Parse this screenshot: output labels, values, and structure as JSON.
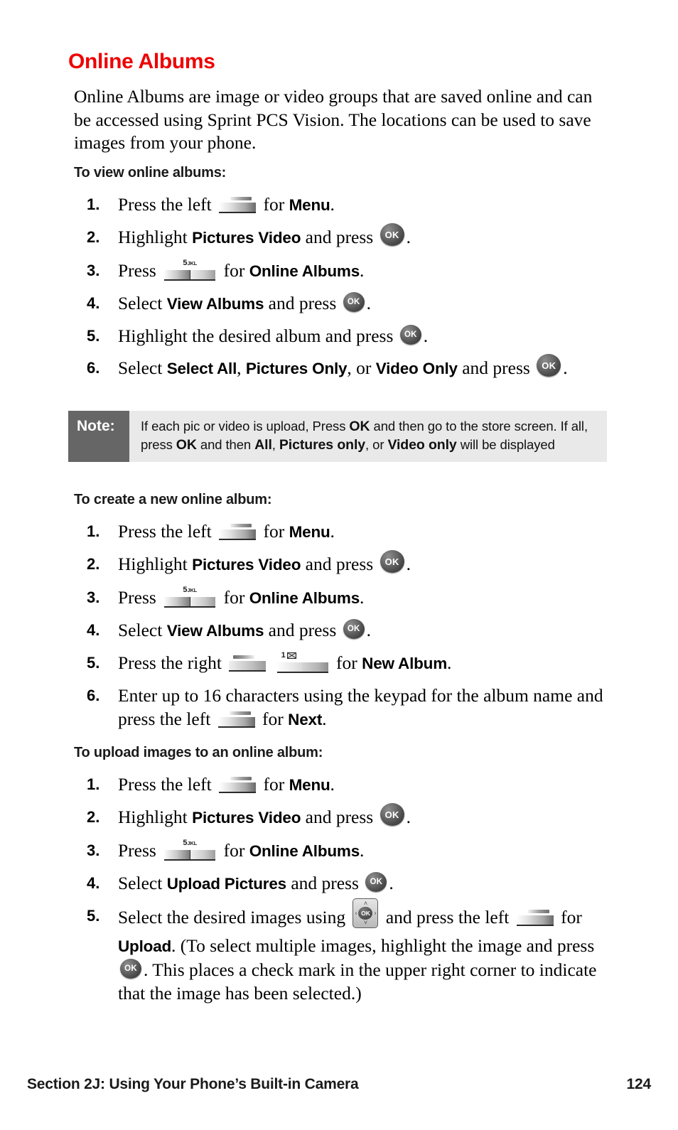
{
  "document": {
    "title": "Online Albums",
    "title_color": "#ee0000",
    "intro": "Online Albums are image or video groups that are saved online and can be accessed using Sprint PCS Vision. The locations can be used to save images from your phone."
  },
  "sections": {
    "view": {
      "heading": "To view online albums:",
      "steps": {
        "s1": {
          "num": "1.",
          "a": "Press the left",
          "b": "for",
          "strong": "Menu",
          "tail": "."
        },
        "s2": {
          "num": "2.",
          "a": "Highlight",
          "strong": "Pictures Video",
          "b": "and press",
          "tail": "."
        },
        "s3": {
          "num": "3.",
          "a": "Press",
          "b": "for",
          "strong": "Online Albums",
          "tail": "."
        },
        "s4": {
          "num": "4.",
          "a": "Select",
          "strong": "View Albums",
          "b": "and press",
          "tail": "."
        },
        "s5": {
          "num": "5.",
          "a": "Highlight the desired album and press",
          "tail": "."
        },
        "s6": {
          "num": "6.",
          "a": "Select",
          "strong1": "Select All",
          "sep1": ",",
          "strong2": "Pictures Only",
          "sep2": ", or",
          "strong3": "Video Only",
          "b": "and press",
          "tail": "."
        }
      }
    },
    "create": {
      "heading": "To create a new online album:",
      "steps": {
        "s1": {
          "num": "1.",
          "a": "Press the left",
          "b": "for",
          "strong": "Menu",
          "tail": "."
        },
        "s2": {
          "num": "2.",
          "a": "Highlight",
          "strong": "Pictures Video",
          "b": "and press",
          "tail": "."
        },
        "s3": {
          "num": "3.",
          "a": "Press",
          "b": "for",
          "strong": "Online Albums",
          "tail": "."
        },
        "s4": {
          "num": "4.",
          "a": "Select",
          "strong": "View Albums",
          "b": "and press",
          "tail": "."
        },
        "s5": {
          "num": "5.",
          "a": "Press the right",
          "b": "for",
          "strong": "New Album",
          "tail": "."
        },
        "s6": {
          "num": "6.",
          "a": "Enter up to 16 characters using the keypad for the album name and press the left",
          "b": "for",
          "strong": "Next",
          "tail": "."
        }
      }
    },
    "upload": {
      "heading": "To upload images to an online album:",
      "steps": {
        "s1": {
          "num": "1.",
          "a": "Press the left",
          "b": "for",
          "strong": "Menu",
          "tail": "."
        },
        "s2": {
          "num": "2.",
          "a": "Highlight",
          "strong": "Pictures Video",
          "b": "and press",
          "tail": "."
        },
        "s3": {
          "num": "3.",
          "a": "Press",
          "b": "for",
          "strong": "Online Albums",
          "tail": "."
        },
        "s4": {
          "num": "4.",
          "a": "Select",
          "strong": "Upload Pictures",
          "b": "and press",
          "tail": "."
        },
        "s5": {
          "num": "5.",
          "a": "Select the desired images using",
          "b": "and press the left",
          "c": "for",
          "strong": "Upload",
          "d": ". (To select multiple images, highlight the image and press",
          "e": ". This places a check mark in the upper right corner to indicate that the image has been selected.)"
        }
      }
    }
  },
  "note": {
    "label": "Note:",
    "line1_a": "If each pic or video is upload, Press",
    "line1_b": "OK",
    "line1_c": "and then go to the store screen.",
    "line2_a": "If all, press",
    "line2_b": "OK",
    "line2_c": "and then",
    "line2_d": "All",
    "line2_e": ",",
    "line2_f": "Pictures only",
    "line2_g": ", or",
    "line2_h": "Video only",
    "line2_i": "will be",
    "line3": "displayed",
    "label_bg": "#666666",
    "body_bg": "#e9e9e9"
  },
  "icons": {
    "softkey_left": "softkey-left-icon",
    "softkey_right": "softkey-right-icon",
    "key5": {
      "digit": "5",
      "letters": "JKL"
    },
    "key1": {
      "digit": "1",
      "glyph": "envelope"
    },
    "ok_button": "OK",
    "nav_pad": {
      "center": "OK",
      "up": "˄",
      "down": "˅",
      "left": "‹",
      "right": "›"
    }
  },
  "footer": {
    "section": "Section 2J: Using Your Phone’s Built-in Camera",
    "page": "124"
  }
}
